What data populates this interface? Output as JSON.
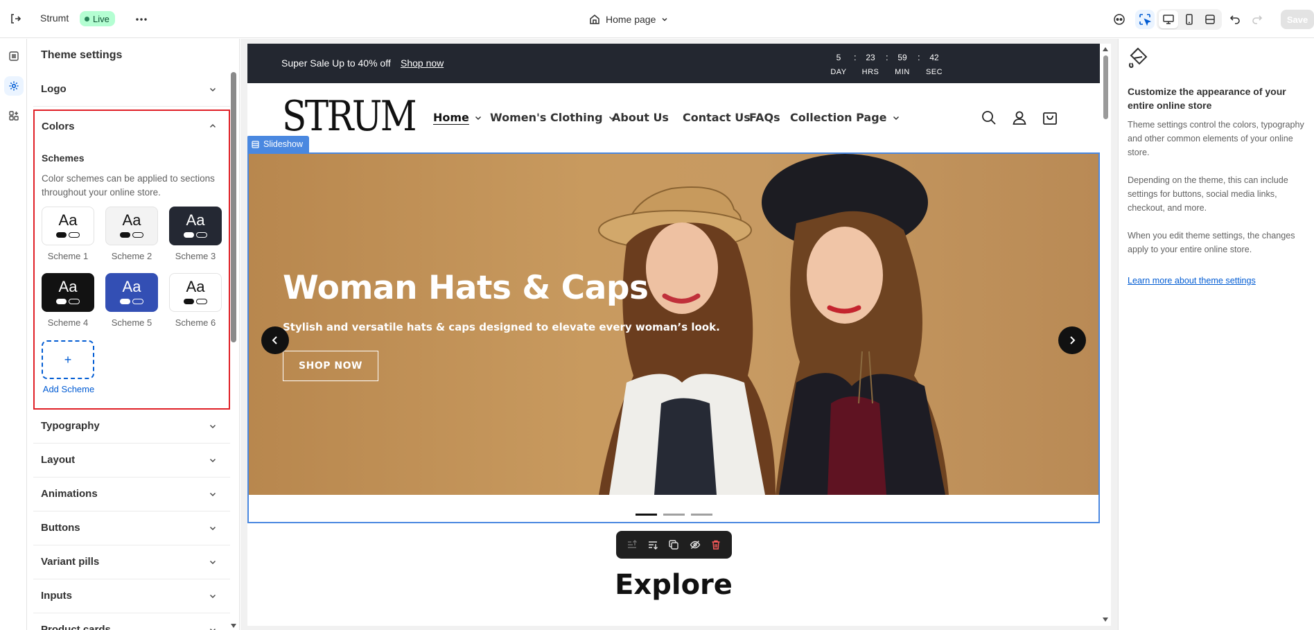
{
  "topbar": {
    "store_name": "Strumt",
    "live_badge": "Live",
    "page_selector": "Home page",
    "save_label": "Save"
  },
  "panel": {
    "title": "Theme settings",
    "sections_before": [
      {
        "label": "Logo"
      }
    ],
    "colors": {
      "label": "Colors",
      "schemes_heading": "Schemes",
      "schemes_description": "Color schemes can be applied to sections throughout your online store.",
      "schemes": [
        {
          "name": "Scheme 1",
          "sample": "Aa",
          "bg": "#ffffff",
          "fg": "#121212",
          "btn": "#121212",
          "btn2": "#ffffff",
          "outline": "#121212"
        },
        {
          "name": "Scheme 2",
          "sample": "Aa",
          "bg": "#f3f3f3",
          "fg": "#121212",
          "btn": "#121212",
          "btn2": "#f3f3f3",
          "outline": "#121212"
        },
        {
          "name": "Scheme 3",
          "sample": "Aa",
          "bg": "#242833",
          "fg": "#ffffff",
          "btn": "#ffffff",
          "btn2": "#242833",
          "outline": "#ffffff"
        },
        {
          "name": "Scheme 4",
          "sample": "Aa",
          "bg": "#121212",
          "fg": "#ffffff",
          "btn": "#ffffff",
          "btn2": "#121212",
          "outline": "#ffffff"
        },
        {
          "name": "Scheme 5",
          "sample": "Aa",
          "bg": "#334fb4",
          "fg": "#ffffff",
          "btn": "#ffffff",
          "btn2": "#334fb4",
          "outline": "#ffffff"
        },
        {
          "name": "Scheme 6",
          "sample": "Aa",
          "bg": "#ffffff",
          "fg": "#121212",
          "btn": "#121212",
          "btn2": "#ffffff",
          "outline": "#121212"
        }
      ],
      "add_scheme_icon": "+",
      "add_scheme_label": "Add Scheme"
    },
    "sections_after": [
      {
        "label": "Typography"
      },
      {
        "label": "Layout"
      },
      {
        "label": "Animations"
      },
      {
        "label": "Buttons"
      },
      {
        "label": "Variant pills"
      },
      {
        "label": "Inputs"
      },
      {
        "label": "Product cards"
      }
    ]
  },
  "preview": {
    "announcement": {
      "message": "Super Sale Up to 40% off",
      "link": "Shop now"
    },
    "countdown": [
      {
        "value": "5",
        "label": "DAY"
      },
      {
        "value": "23",
        "label": "HRS"
      },
      {
        "value": "59",
        "label": "MIN"
      },
      {
        "value": "42",
        "label": "SEC"
      }
    ],
    "countdown_separator": ":",
    "logo": "STRUM",
    "nav": [
      {
        "label": "Home",
        "dropdown": true,
        "active": true
      },
      {
        "label": "Women's Clothing",
        "dropdown": true
      },
      {
        "label": "About Us",
        "dropdown": false
      },
      {
        "label": "Contact Us",
        "dropdown": false
      },
      {
        "label": "FAQs",
        "dropdown": false
      },
      {
        "label": "Collection Page",
        "dropdown": true
      }
    ],
    "section_tag": "Slideshow",
    "hero": {
      "title": "Woman Hats & Caps",
      "subtitle": "Stylish and versatile hats & caps designed to elevate every woman’s look.",
      "button": "SHOP NOW"
    },
    "slides_total": 3,
    "slide_active": 1,
    "next_heading": "Explore"
  },
  "info": {
    "heading": "Customize the appearance of your entire online store",
    "paragraphs": [
      "Theme settings control the colors, typography and other common elements of your online store.",
      "Depending on the theme, this can include settings for buttons, social media links, checkout, and more.",
      "When you edit theme settings, the changes apply to your entire online store."
    ],
    "link": "Learn more about theme settings"
  },
  "colors": {
    "accent": "#005bd3",
    "selection_outline": "#e01f26",
    "preview_frame": "#4a88e0",
    "announcement_bg": "#232730"
  }
}
